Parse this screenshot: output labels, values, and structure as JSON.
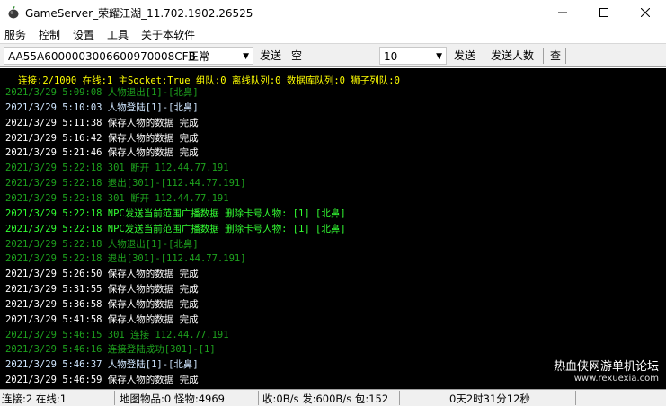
{
  "window": {
    "title": "GameServer_荣耀江湖_11.702.1902.26525",
    "controls": [
      "minimize-icon",
      "maximize-icon",
      "close-icon"
    ]
  },
  "menu": {
    "items": [
      "服务",
      "控制",
      "设置",
      "工具",
      "关于本软件"
    ]
  },
  "toolbar": {
    "id_combo": "AA55A6000003006600970008CFB",
    "mode_combo": "正常",
    "send1": "发送",
    "text1": "空",
    "count_combo": "10",
    "send2": "发送",
    "send_people": "发送人数",
    "query": "查"
  },
  "log": {
    "header": "连接:2/1000 在线:1 主Socket:True 组队:0 离线队列:0 数据库队列:0 狮子列队:0",
    "lines": [
      {
        "text": "2021/3/29  5:09:08 人物退出[1]-[北鼻]",
        "color": "green"
      },
      {
        "text": "2021/3/29  5:10:03 人物登陆[1]-[北鼻]",
        "color": "blue"
      },
      {
        "text": "2021/3/29  5:11:38 保存人物的数据 完成",
        "color": "white"
      },
      {
        "text": "2021/3/29  5:16:42 保存人物的数据 完成",
        "color": "white"
      },
      {
        "text": "2021/3/29  5:21:46 保存人物的数据 完成",
        "color": "white"
      },
      {
        "text": "2021/3/29  5:22:18 301 断开 112.44.77.191",
        "color": "green"
      },
      {
        "text": "2021/3/29  5:22:18 退出[301]-[112.44.77.191]",
        "color": "green"
      },
      {
        "text": "2021/3/29  5:22:18 301 断开 112.44.77.191",
        "color": "green"
      },
      {
        "text": "2021/3/29  5:22:18 NPC发送当前范围广播数据 删除卡号人物: [1] [北鼻]",
        "color": "bright"
      },
      {
        "text": "2021/3/29  5:22:18 NPC发送当前范围广播数据 删除卡号人物: [1] [北鼻]",
        "color": "bright"
      },
      {
        "text": "2021/3/29  5:22:18 人物退出[1]-[北鼻]",
        "color": "green"
      },
      {
        "text": "2021/3/29  5:22:18 退出[301]-[112.44.77.191]",
        "color": "green"
      },
      {
        "text": "2021/3/29  5:26:50 保存人物的数据 完成",
        "color": "white"
      },
      {
        "text": "2021/3/29  5:31:55 保存人物的数据 完成",
        "color": "white"
      },
      {
        "text": "2021/3/29  5:36:58 保存人物的数据 完成",
        "color": "white"
      },
      {
        "text": "2021/3/29  5:41:58 保存人物的数据 完成",
        "color": "white"
      },
      {
        "text": "2021/3/29  5:46:15 301 连接 112.44.77.191",
        "color": "green"
      },
      {
        "text": "2021/3/29  5:46:16 连接登陆成功[301]-[1]",
        "color": "green"
      },
      {
        "text": "2021/3/29  5:46:37 人物登陆[1]-[北鼻]",
        "color": "blue"
      },
      {
        "text": "2021/3/29  5:46:59 保存人物的数据 完成",
        "color": "white"
      }
    ]
  },
  "watermark": {
    "line1": "热血侠网游单机论坛",
    "line2": "www.rexuexia.com"
  },
  "status": {
    "conn": "连接:2 在线:1",
    "map": "地图物品:0 怪物:4969",
    "traffic": "收:0B/s 发:600B/s 包:152",
    "uptime": "0天2时31分12秒"
  },
  "colors": {
    "log_bg": "#000000",
    "header": "#ffff00",
    "white": "#ffffff",
    "green": "#1ea21e",
    "bright": "#33ff33",
    "blue": "#cfe6ff"
  }
}
